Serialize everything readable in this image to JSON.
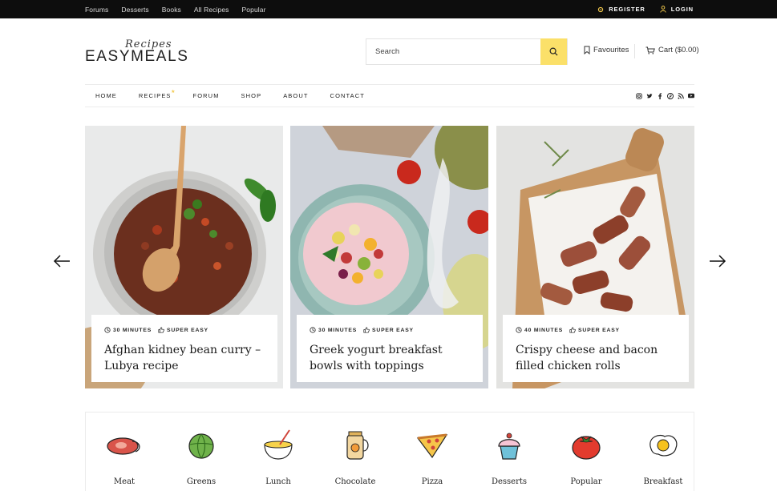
{
  "topbar": {
    "links": [
      "Forums",
      "Desserts",
      "Books",
      "All Recipes",
      "Popular"
    ],
    "register": "REGISTER",
    "login": "LOGIN"
  },
  "header": {
    "logo_script": "Recipes",
    "logo_word": "EASYMEALS",
    "search_placeholder": "Search",
    "favourites": "Favourites",
    "cart": "Cart ($0.00)"
  },
  "nav": {
    "items": [
      "HOME",
      "RECIPES",
      "FORUM",
      "SHOP",
      "ABOUT",
      "CONTACT"
    ],
    "social_icons": [
      "instagram-icon",
      "twitter-icon",
      "facebook-icon",
      "pinterest-icon",
      "rss-icon",
      "youtube-icon"
    ]
  },
  "slides": [
    {
      "time": "30 MINUTES",
      "level": "SUPER EASY",
      "title": "Afghan kidney bean curry – Lubya recipe"
    },
    {
      "time": "30 MINUTES",
      "level": "SUPER EASY",
      "title": "Greek yogurt breakfast bowls with toppings"
    },
    {
      "time": "40 MINUTES",
      "level": "SUPER EASY",
      "title": "Crispy cheese and bacon filled chicken rolls"
    }
  ],
  "categories": [
    {
      "label": "Meat",
      "icon": "steak-icon"
    },
    {
      "label": "Greens",
      "icon": "cabbage-icon"
    },
    {
      "label": "Lunch",
      "icon": "bowl-icon"
    },
    {
      "label": "Chocolate",
      "icon": "jar-icon"
    },
    {
      "label": "Pizza",
      "icon": "pizza-icon"
    },
    {
      "label": "Desserts",
      "icon": "cupcake-icon"
    },
    {
      "label": "Popular",
      "icon": "tomato-icon"
    },
    {
      "label": "Breakfast",
      "icon": "egg-icon"
    }
  ],
  "colors": {
    "accent": "#fbe069",
    "topbar_bg": "#0d0d0d"
  }
}
